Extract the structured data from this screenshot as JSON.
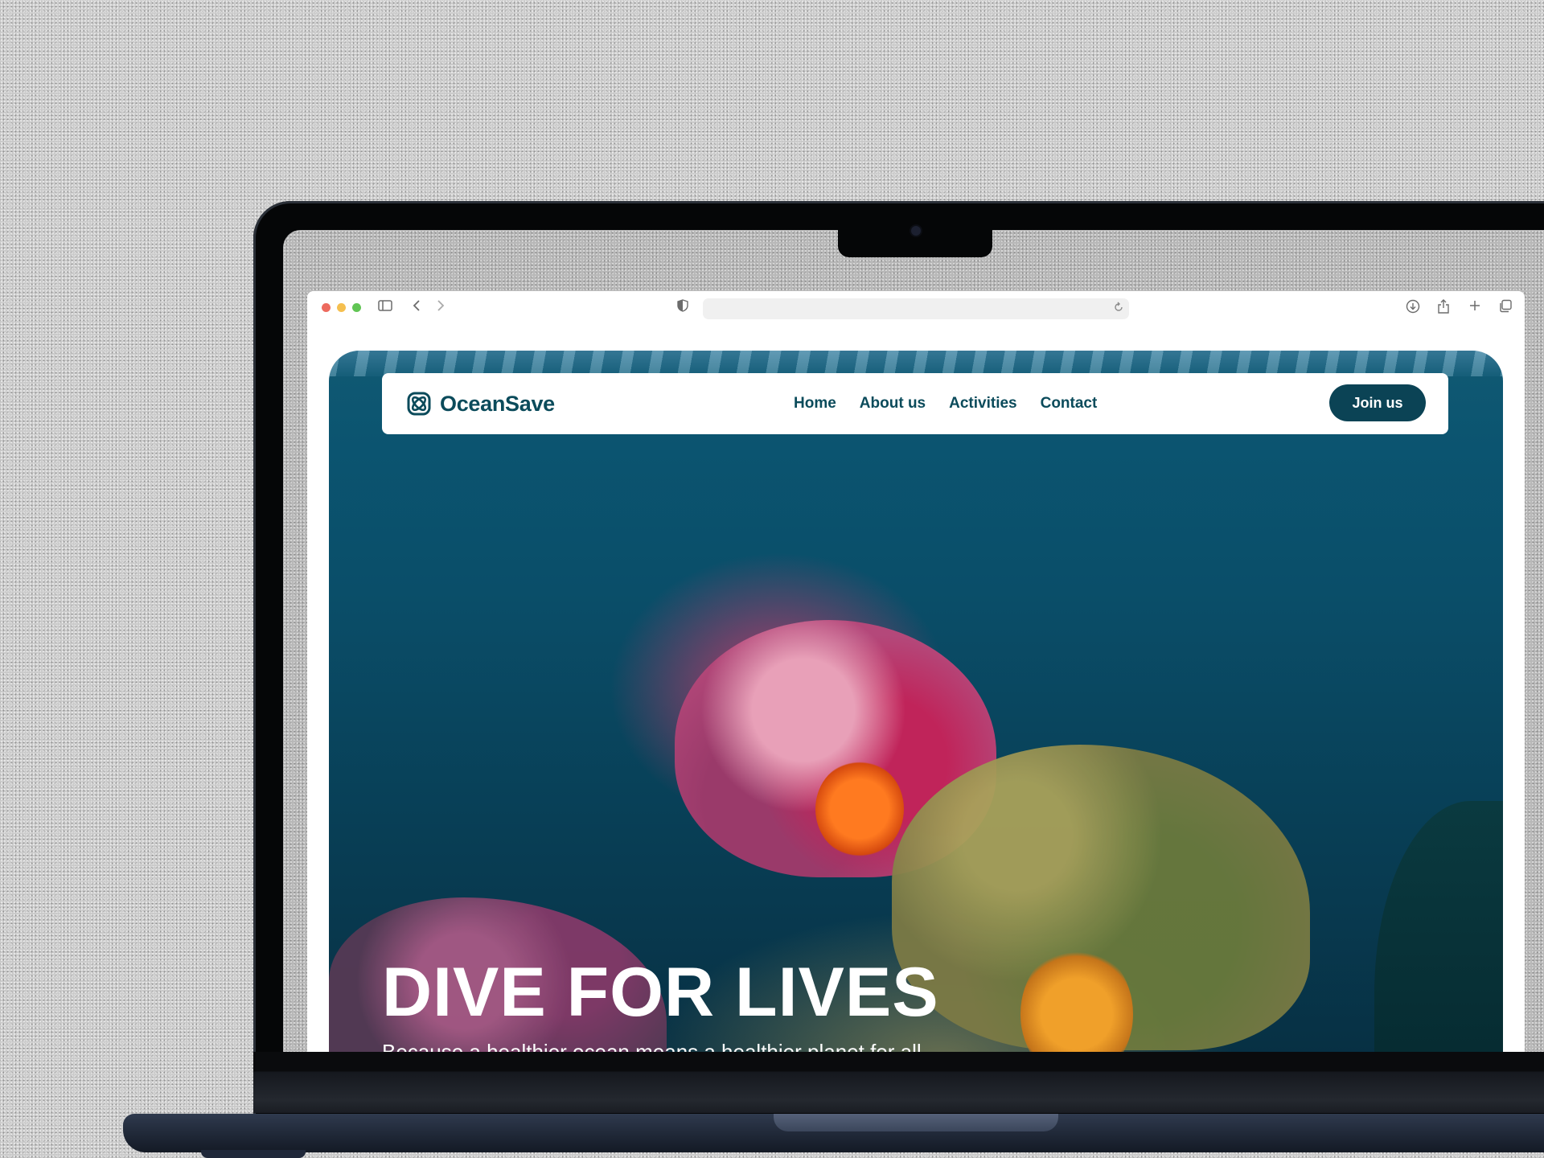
{
  "site": {
    "brand": "OceanSave",
    "nav": {
      "items": [
        {
          "label": "Home"
        },
        {
          "label": "About us"
        },
        {
          "label": "Activities"
        },
        {
          "label": "Contact"
        }
      ],
      "cta_label": "Join us"
    },
    "hero": {
      "title": "DIVE FOR LIVES",
      "subtitle": "Because a healthier ocean means a healthier planet for all"
    }
  },
  "browser": {
    "address": ""
  },
  "icons": {
    "sidebar": "sidebar-toggle-icon",
    "back": "chevron-left-icon",
    "forward": "chevron-right-icon",
    "privacy": "shield-icon",
    "reload": "reload-icon",
    "download": "download-icon",
    "share": "share-icon",
    "new_tab": "plus-icon",
    "tabs": "tabs-overview-icon"
  },
  "colors": {
    "brand_teal": "#0b4b5b",
    "cta_bg": "#0b4355",
    "cta_text": "#ffffff",
    "hero_text": "#ffffff"
  }
}
